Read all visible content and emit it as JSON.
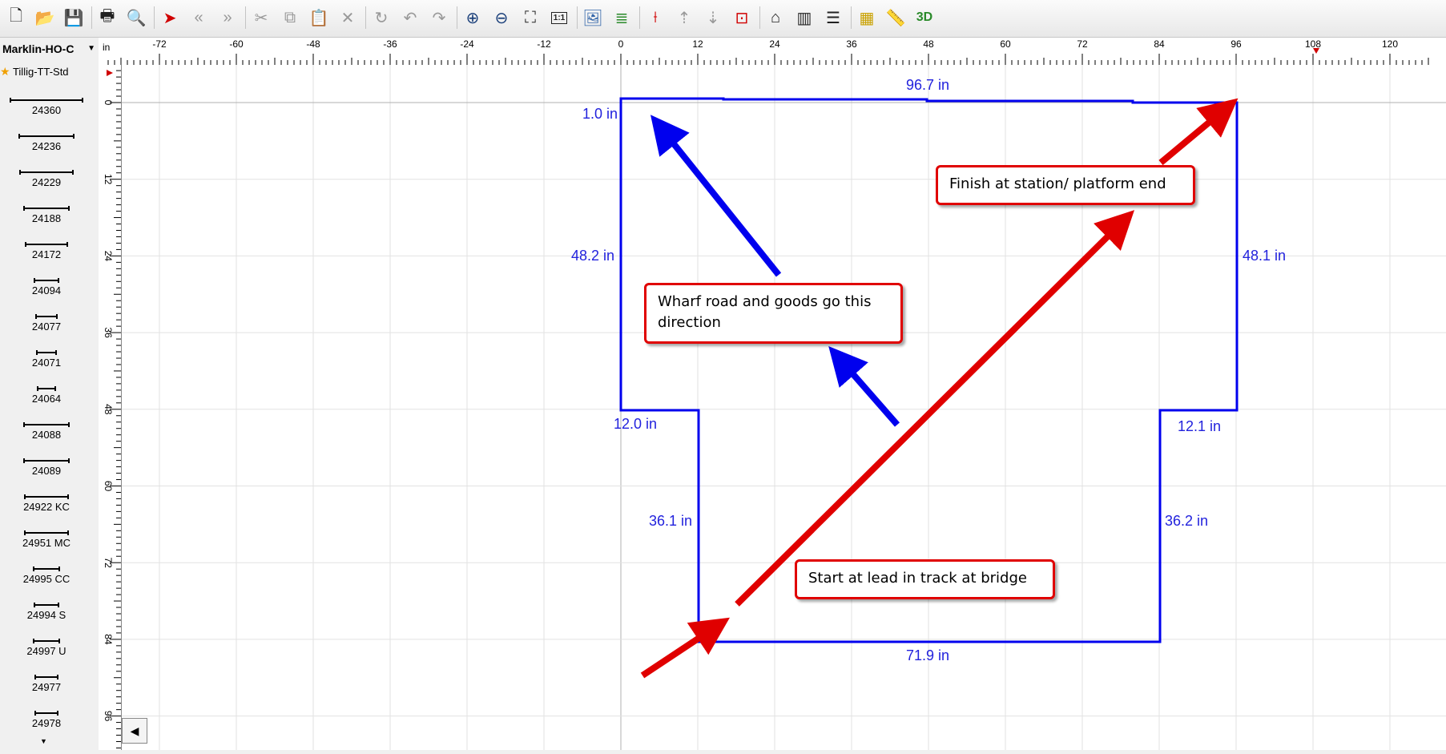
{
  "toolbar": {
    "buttons": [
      {
        "name": "new-file-icon"
      },
      {
        "name": "open-folder-icon"
      },
      {
        "name": "save-icon"
      },
      {
        "name": "print-icon"
      },
      {
        "name": "print-preview-icon"
      },
      {
        "name": "select-arrow-icon"
      },
      {
        "name": "rewind-icon"
      },
      {
        "name": "forward-icon"
      },
      {
        "name": "cut-icon"
      },
      {
        "name": "copy-icon"
      },
      {
        "name": "paste-icon"
      },
      {
        "name": "delete-icon"
      },
      {
        "name": "rotate-icon"
      },
      {
        "name": "undo-icon"
      },
      {
        "name": "redo-icon"
      },
      {
        "name": "zoom-in-icon"
      },
      {
        "name": "zoom-out-icon"
      },
      {
        "name": "zoom-fit-icon"
      },
      {
        "name": "zoom-1-1-icon"
      },
      {
        "name": "background-image-icon"
      },
      {
        "name": "layers-icon"
      },
      {
        "name": "track-split-icon"
      },
      {
        "name": "height-up-icon"
      },
      {
        "name": "height-down-icon"
      },
      {
        "name": "isolate-icon"
      },
      {
        "name": "bridge-icon"
      },
      {
        "name": "tunnel-icon"
      },
      {
        "name": "track-options-icon"
      },
      {
        "name": "parts-list-icon"
      },
      {
        "name": "measure-icon"
      },
      {
        "name": "view-3d-icon"
      }
    ],
    "zoom_1_1_label": "1:1",
    "view_3d_label": "3D"
  },
  "sidebar": {
    "library": "Marklin-HO-C",
    "favorite": "Tillig-TT-Std",
    "items": [
      {
        "label": "24360",
        "w": 88
      },
      {
        "label": "24236",
        "w": 66
      },
      {
        "label": "24229",
        "w": 64
      },
      {
        "label": "24188",
        "w": 54
      },
      {
        "label": "24172",
        "w": 50
      },
      {
        "label": "24094",
        "w": 28
      },
      {
        "label": "24077",
        "w": 24
      },
      {
        "label": "24071",
        "w": 22
      },
      {
        "label": "24064",
        "w": 20
      },
      {
        "label": "24088",
        "w": 54
      },
      {
        "label": "24089",
        "w": 54
      },
      {
        "label": "24922 KC",
        "w": 52
      },
      {
        "label": "24951 MC",
        "w": 52
      },
      {
        "label": "24995 CC",
        "w": 30
      },
      {
        "label": "24994 S",
        "w": 28
      },
      {
        "label": "24997 U",
        "w": 30
      },
      {
        "label": "24977",
        "w": 26
      },
      {
        "label": "24978",
        "w": 26
      }
    ]
  },
  "ruler": {
    "unit": "in",
    "top_labels": [
      "-72",
      "-60",
      "-48",
      "-36",
      "-24",
      "-12",
      "0",
      "12",
      "24",
      "36",
      "48",
      "60",
      "72",
      "84",
      "96",
      "108",
      "120"
    ],
    "left_labels": [
      "0",
      "12",
      "24",
      "36",
      "48",
      "60",
      "72",
      "84",
      "96"
    ]
  },
  "layout_outline": {
    "dimensions": {
      "top": "96.7 in",
      "top_left_notch": "1.0 in",
      "left_upper": "48.2 in",
      "right_upper": "48.1 in",
      "left_step": "12.0 in",
      "right_step": "12.1 in",
      "left_lower": "36.1 in",
      "right_lower": "36.2 in",
      "bottom": "71.9 in"
    },
    "outline_color": "#0000ff"
  },
  "annotations": {
    "finish": "Finish at station/ platform end",
    "wharf": "Wharf road and goods go this direction",
    "start": "Start at lead in track at bridge",
    "arrow_red": "#e00000",
    "arrow_blue": "#0000ee"
  }
}
